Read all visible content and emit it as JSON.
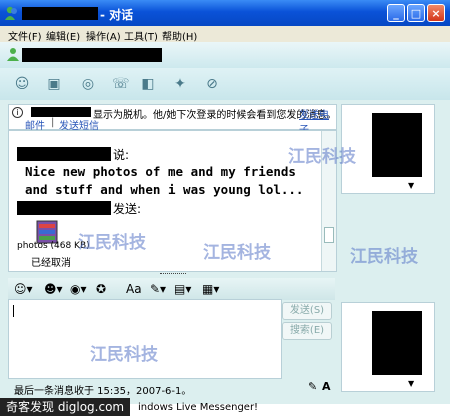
{
  "window": {
    "title": "- 对话"
  },
  "menu": [
    "文件(F)",
    "编辑(E)",
    "操作(A)",
    "工具(T)",
    "帮助(H)"
  ],
  "info": {
    "text": "显示为脱机。他/她下次登录的时候会看到您发的消息。",
    "link1": "发送电子",
    "link2": "邮件",
    "sep": "|",
    "link3": "发送短信"
  },
  "conversation": {
    "said": "说:",
    "message_line1": "Nice new photos of me and my friends",
    "message_line2": "and stuff and when i was young lol...",
    "sent": "发送:",
    "file_name": "photos (468 KB)",
    "file_status": "已经取消"
  },
  "buttons": {
    "send": "发送(S)",
    "search": "搜索(E)"
  },
  "status": {
    "last_message": "最后一条消息收于 15:35，2007-6-1。"
  },
  "footer": {
    "site": "奇客发现 diglog.com",
    "text": "indows Live Messenger!"
  },
  "watermark": "江民科技"
}
